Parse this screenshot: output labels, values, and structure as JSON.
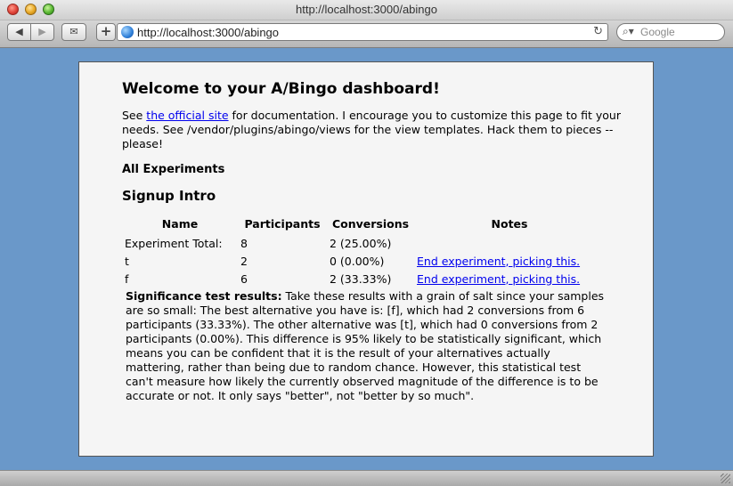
{
  "window": {
    "title": "http://localhost:3000/abingo"
  },
  "toolbar": {
    "back_icon": "◀",
    "forward_icon": "▶",
    "clip_icon": "✉",
    "add_icon": "+",
    "url": "http://localhost:3000/abingo",
    "reload_icon": "↻",
    "search_icon": "⌕▾",
    "search_placeholder": "Google"
  },
  "page": {
    "heading": "Welcome to your A/Bingo dashboard!",
    "intro_before": "See ",
    "intro_link": "the official site",
    "intro_after": " for documentation. I encourage you to customize this page to fit your needs. See /vendor/plugins/abingo/views for the view templates. Hack them to pieces -- please!",
    "section_title": "All Experiments",
    "experiment": {
      "name": "Signup Intro",
      "columns": [
        "Name",
        "Participants",
        "Conversions",
        "Notes"
      ],
      "rows": [
        {
          "name": "Experiment Total:",
          "participants": "8",
          "conversions": "2 (25.00%)",
          "notes": ""
        },
        {
          "name": "t",
          "participants": "2",
          "conversions": "0 (0.00%)",
          "notes": "End experiment, picking this."
        },
        {
          "name": "f",
          "participants": "6",
          "conversions": "2 (33.33%)",
          "notes": "End experiment, picking this."
        }
      ],
      "significance_label": "Significance test results:",
      "significance_text": " Take these results with a grain of salt since your samples are so small: The best alternative you have is: [f], which had 2 conversions from 6 participants (33.33%). The other alternative was [t], which had 0 conversions from 2 participants (0.00%). This difference is 95% likely to be statistically significant, which means you can be confident that it is the result of your alternatives actually mattering, rather than being due to random chance. However, this statistical test can't measure how likely the currently observed magnitude of the difference is to be accurate or not. It only says \"better\", not \"better by so much\"."
    }
  },
  "colors": {
    "desktop_bg": "#6a98c9",
    "page_bg": "#f5f5f5",
    "link": "#0000ee"
  }
}
